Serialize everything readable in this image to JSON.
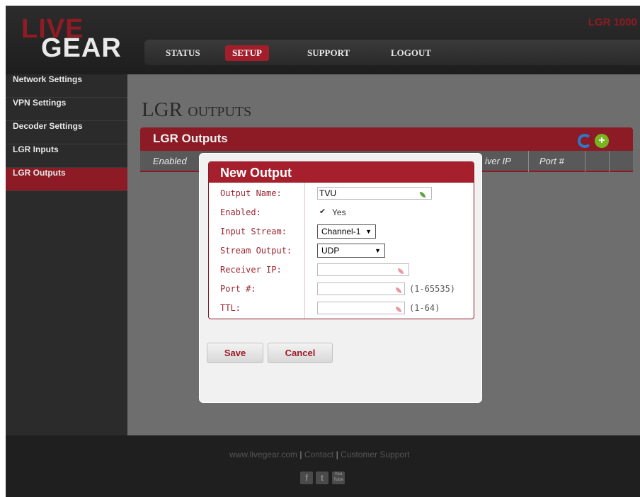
{
  "brand": {
    "logo_top": "LIVE",
    "logo_bottom": "GEAR",
    "model": "LGR 1000"
  },
  "nav": {
    "items": [
      {
        "label": "STATUS",
        "active": false
      },
      {
        "label": "SETUP",
        "active": true
      },
      {
        "label": "SUPPORT",
        "active": false
      },
      {
        "label": "LOGOUT",
        "active": false
      }
    ]
  },
  "sidebar": {
    "items": [
      {
        "label": "Network Settings",
        "active": false
      },
      {
        "label": "VPN Settings",
        "active": false
      },
      {
        "label": "Decoder Settings",
        "active": false
      },
      {
        "label": "LGR Inputs",
        "active": false
      },
      {
        "label": "LGR Outputs",
        "active": true
      }
    ]
  },
  "page": {
    "title": "LGR outputs",
    "panel_title": "LGR Outputs",
    "columns": [
      "Enabled",
      "iver IP",
      "Port #"
    ]
  },
  "modal": {
    "title": "New Output",
    "fields": {
      "output_name": {
        "label": "Output Name:",
        "value": "TVU"
      },
      "enabled": {
        "label": "Enabled:",
        "checked": true,
        "option_label": "Yes"
      },
      "input_stream": {
        "label": "Input Stream:",
        "value": "Channel-1"
      },
      "stream_output": {
        "label": "Stream Output:",
        "value": "UDP"
      },
      "receiver_ip": {
        "label": "Receiver IP:",
        "value": ""
      },
      "port": {
        "label": "Port #:",
        "value": "",
        "hint": "(1-65535)"
      },
      "ttl": {
        "label": "TTL:",
        "value": "",
        "hint": "(1-64)"
      }
    },
    "buttons": {
      "save": "Save",
      "cancel": "Cancel"
    }
  },
  "footer": {
    "link_site": "www.livegear.com",
    "link_contact": "Contact",
    "link_support": "Customer Support",
    "separator": "|",
    "social": {
      "facebook": "f",
      "twitter": "t",
      "youtube": "You Tube"
    }
  },
  "colors": {
    "brand_red": "#8c1b25",
    "accent_blue": "#2c78c9",
    "accent_green": "#7ab320"
  }
}
